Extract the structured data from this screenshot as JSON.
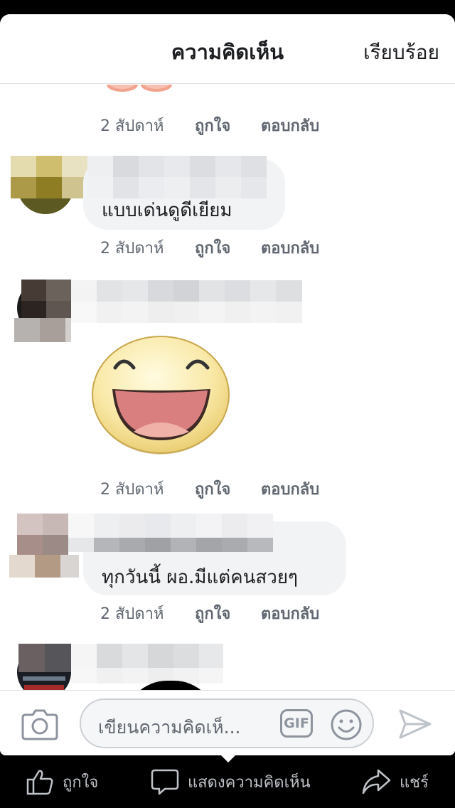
{
  "header": {
    "title": "ความคิดเห็น",
    "done_label": "เรียบร้อย"
  },
  "comments": [
    {
      "text": "",
      "time": "2 สัปดาห์",
      "like": "ถูกใจ",
      "reply": "ตอบกลับ"
    },
    {
      "text": "แบบเด่นดูดีเยียม",
      "time": "2 สัปดาห์",
      "like": "ถูกใจ",
      "reply": "ตอบกลับ"
    },
    {
      "text": "",
      "time": "2 สัปดาห์",
      "like": "ถูกใจ",
      "reply": "ตอบกลับ"
    },
    {
      "text": "ทุกวันนี้ ผอ.มีแต่คนสวยๆ",
      "time": "2 สัปดาห์",
      "like": "ถูกใจ",
      "reply": "ตอบกลับ"
    }
  ],
  "composer": {
    "placeholder": "เขียนความคิดเห็...",
    "gif_label": "GIF"
  },
  "bottom_bar": {
    "like_label": "ถูกใจ",
    "comment_label": "แสดงความคิดเห็น",
    "share_label": "แชร์"
  },
  "icons": [
    "camera-icon",
    "gif-icon",
    "emoji-icon",
    "send-icon",
    "thumbs-up-icon",
    "comment-icon",
    "share-icon"
  ],
  "colors": {
    "text": "#1c1e21",
    "meta": "#606770",
    "bubble": "#f2f3f5"
  }
}
